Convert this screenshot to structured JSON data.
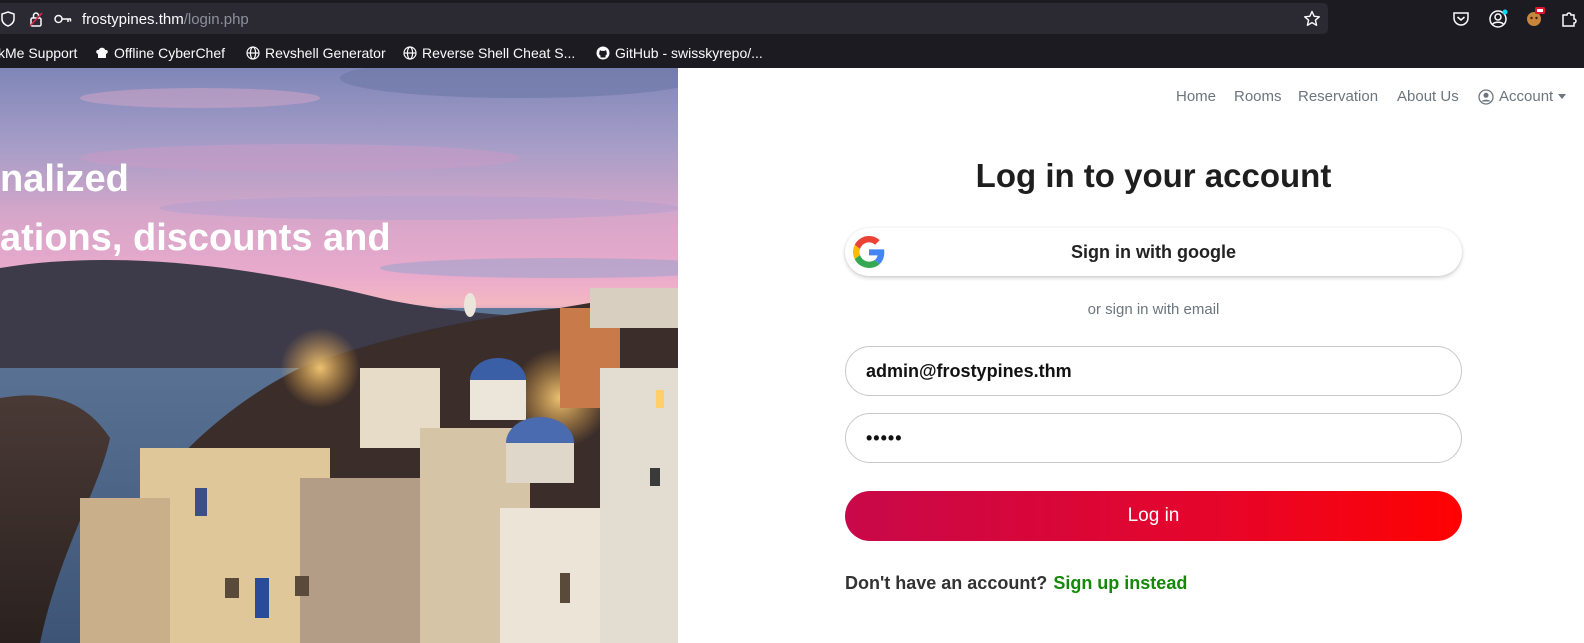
{
  "browser": {
    "url_host": "frostypines.thm",
    "url_path": "/login.php",
    "bookmarks": [
      {
        "label": "kMe Support",
        "icon": "none"
      },
      {
        "label": "Offline CyberChef",
        "icon": "chef-hat-icon"
      },
      {
        "label": "Revshell Generator",
        "icon": "globe-icon"
      },
      {
        "label": "Reverse Shell Cheat S...",
        "icon": "globe-icon"
      },
      {
        "label": "GitHub - swisskyrepo/...",
        "icon": "github-icon"
      }
    ]
  },
  "hero": {
    "line1": "nalized",
    "line2": "ations, discounts and"
  },
  "nav": {
    "home": "Home",
    "rooms": "Rooms",
    "reservation": "Reservation",
    "about": "About Us",
    "account": "Account"
  },
  "login": {
    "title": "Log in to your account",
    "google_label": "Sign in with google",
    "divider": "or sign in with email",
    "email_value": "admin@frostypines.thm",
    "password_value": "•••••",
    "submit_label": "Log in",
    "no_account_text": "Don't have an account?",
    "signup_link": "Sign up instead"
  },
  "colors": {
    "chrome_bg": "#1c1b22",
    "urlbar_bg": "#2b2a33",
    "login_gradient_start": "#c8084a",
    "login_gradient_end": "#ff0202",
    "signup_link": "#138a07"
  }
}
